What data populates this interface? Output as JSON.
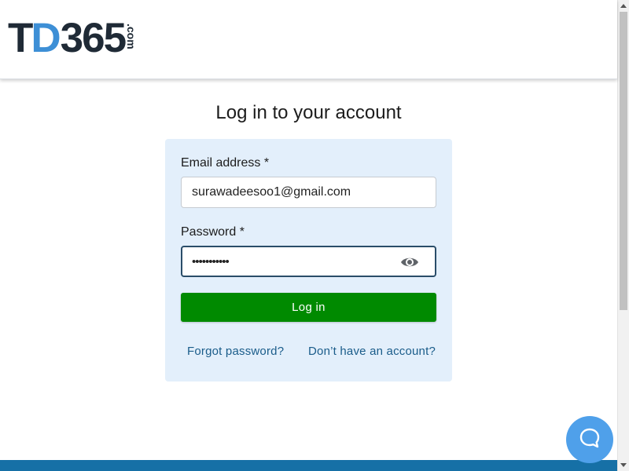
{
  "brand": {
    "logo_t": "T",
    "logo_d": "D",
    "logo_num": "365",
    "logo_com": ".com"
  },
  "page": {
    "title": "Log in to your account"
  },
  "form": {
    "email_label": "Email address *",
    "email_value": "surawadeesoo1@gmail.com",
    "password_label": "Password *",
    "password_value": "•••••••••••",
    "show_password_icon": "eye-icon",
    "login_label": "Log in",
    "forgot_link": "Forgot password?",
    "signup_link": "Don’t have an account?"
  },
  "widgets": {
    "chat_icon": "chat-bubble-icon"
  },
  "colors": {
    "card_bg": "#e3effb",
    "login_button": "#008a00",
    "link": "#1a5c8a",
    "chat_button": "#4fa0ea",
    "footer": "#1670a6",
    "logo_dark": "#1f2a36",
    "logo_blue": "#3d8fd6"
  }
}
